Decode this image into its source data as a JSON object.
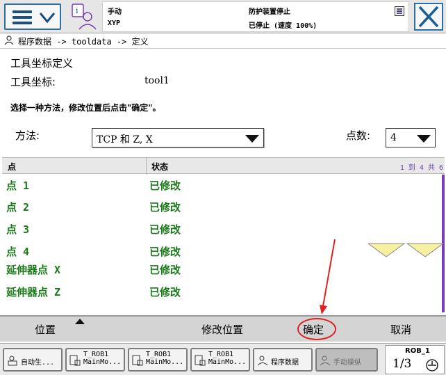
{
  "status": {
    "mode": "手动",
    "controller": "XYP",
    "safety": "防护装置停止",
    "state": "已停止 (速度 100%)"
  },
  "breadcrumb": "程序数据 -> tooldata -> 定义",
  "form": {
    "title": "工具坐标定义",
    "coord_label": "工具坐标:",
    "coord_value": "tool1",
    "instruction": "选择一种方法，修改位置后点击\"确定\"。",
    "method_label": "方法:",
    "method_value": "TCP 和 Z, X",
    "count_label": "点数:",
    "count_value": "4"
  },
  "table": {
    "col_point": "点",
    "col_status": "状态",
    "pager": "1 到 4 共 6",
    "rows": [
      {
        "point": "点  1",
        "status": "已修改"
      },
      {
        "point": "点  2",
        "status": "已修改"
      },
      {
        "point": "点  3",
        "status": "已修改"
      },
      {
        "point": "点  4",
        "status": "已修改"
      },
      {
        "point": "延伸器点  X",
        "status": "已修改"
      },
      {
        "point": "延伸器点  Z",
        "status": "已修改"
      }
    ]
  },
  "actions": {
    "position": "位置",
    "modify": "修改位置",
    "ok": "确定",
    "cancel": "取消"
  },
  "taskbar": {
    "t1": "自动生...",
    "t2a": "T_ROB1",
    "t2b": "MainMo...",
    "t3a": "T_ROB1",
    "t3b": "MainMo...",
    "t4a": "T_ROB1",
    "t4b": "MainMo...",
    "t5": "程序数据",
    "t6": "手动操纵",
    "rob": "ROB_1",
    "fraction": "1/3"
  },
  "colors": {
    "accent_blue": "#2e6fa3",
    "status_green": "#1a7a1a",
    "scroll_purple": "#7a3db8",
    "annotation_red": "#e02020"
  }
}
